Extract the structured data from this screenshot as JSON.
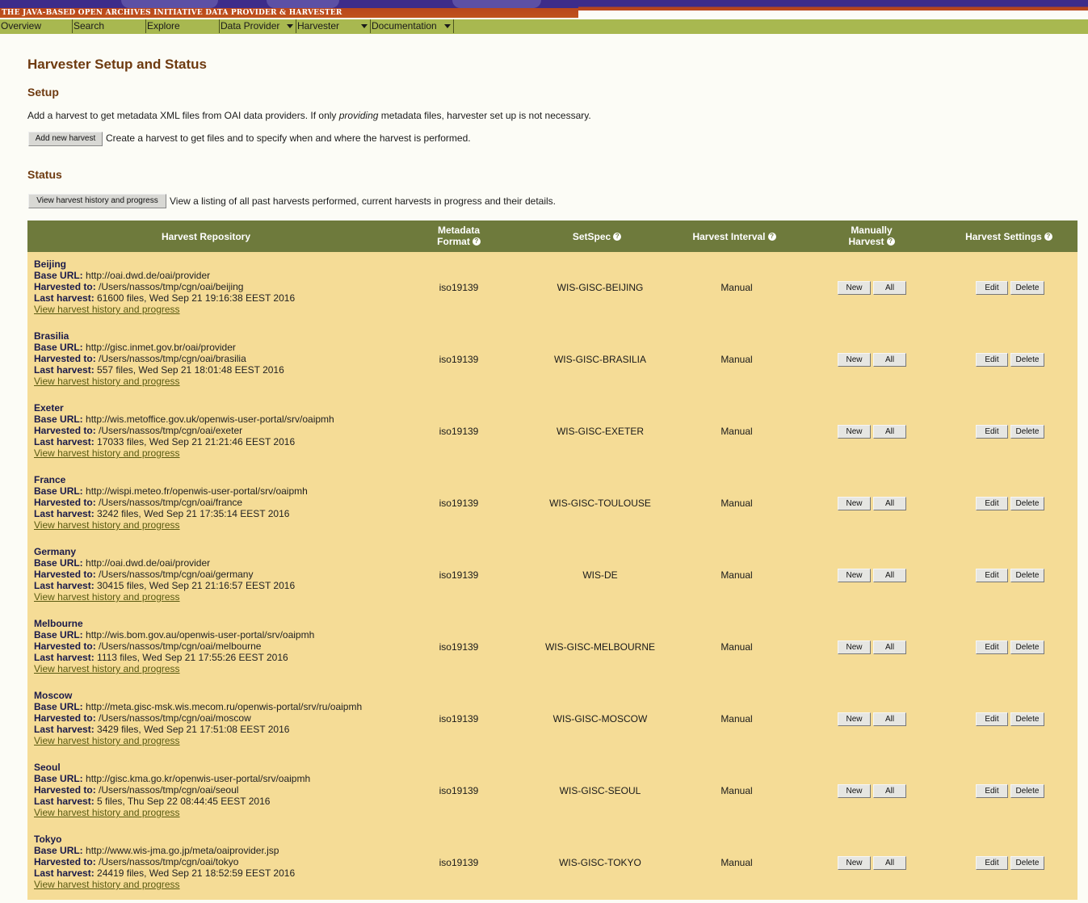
{
  "banner": {
    "title": "THE JAVA-BASED OPEN ARCHIVES INITIATIVE DATA PROVIDER & HARVESTER"
  },
  "nav": [
    {
      "label": "Overview",
      "dropdown": false
    },
    {
      "label": "Search",
      "dropdown": false
    },
    {
      "label": "Explore",
      "dropdown": false
    },
    {
      "label": "Data Provider",
      "dropdown": true
    },
    {
      "label": "Harvester",
      "dropdown": true
    },
    {
      "label": "Documentation",
      "dropdown": true
    }
  ],
  "page_title": "Harvester Setup and Status",
  "setup": {
    "heading": "Setup",
    "desc_before": "Add a harvest to get metadata XML files from OAI data providers. If only ",
    "desc_em": "providing",
    "desc_after": " metadata files, harvester set up is not necessary.",
    "add_button": "Add new harvest",
    "add_desc": "Create a harvest to get files and to specify when and where the harvest is performed."
  },
  "status": {
    "heading": "Status",
    "history_button": "View harvest history and progress",
    "history_desc": "View a listing of all past harvests performed, current harvests in progress and their details."
  },
  "table": {
    "headers": {
      "repository": "Harvest Repository",
      "format_line1": "Metadata",
      "format_line2": "Format",
      "setspec": "SetSpec",
      "interval": "Harvest Interval",
      "manual_line1": "Manually",
      "manual_line2": "Harvest",
      "settings": "Harvest Settings"
    },
    "labels": {
      "base_url": "Base URL:",
      "harvested_to": "Harvested to:",
      "last_harvest": "Last harvest:",
      "history_link": "View harvest history and progress",
      "new": "New",
      "all": "All",
      "edit": "Edit",
      "delete": "Delete"
    },
    "rows": [
      {
        "name": "Beijing",
        "base_url": "http://oai.dwd.de/oai/provider",
        "harvested_to": "/Users/nassos/tmp/cgn/oai/beijing",
        "last_harvest": "61600 files, Wed Sep 21 19:16:38 EEST 2016",
        "format": "iso19139",
        "setspec": "WIS-GISC-BEIJING",
        "interval": "Manual"
      },
      {
        "name": "Brasilia",
        "base_url": "http://gisc.inmet.gov.br/oai/provider",
        "harvested_to": "/Users/nassos/tmp/cgn/oai/brasilia",
        "last_harvest": "557 files, Wed Sep 21 18:01:48 EEST 2016",
        "format": "iso19139",
        "setspec": "WIS-GISC-BRASILIA",
        "interval": "Manual"
      },
      {
        "name": "Exeter",
        "base_url": "http://wis.metoffice.gov.uk/openwis-user-portal/srv/oaipmh",
        "harvested_to": "/Users/nassos/tmp/cgn/oai/exeter",
        "last_harvest": "17033 files, Wed Sep 21 21:21:46 EEST 2016",
        "format": "iso19139",
        "setspec": "WIS-GISC-EXETER",
        "interval": "Manual"
      },
      {
        "name": "France",
        "base_url": "http://wispi.meteo.fr/openwis-user-portal/srv/oaipmh",
        "harvested_to": "/Users/nassos/tmp/cgn/oai/france",
        "last_harvest": "3242 files, Wed Sep 21 17:35:14 EEST 2016",
        "format": "iso19139",
        "setspec": "WIS-GISC-TOULOUSE",
        "interval": "Manual"
      },
      {
        "name": "Germany",
        "base_url": "http://oai.dwd.de/oai/provider",
        "harvested_to": "/Users/nassos/tmp/cgn/oai/germany",
        "last_harvest": "30415 files, Wed Sep 21 21:16:57 EEST 2016",
        "format": "iso19139",
        "setspec": "WIS-DE",
        "interval": "Manual"
      },
      {
        "name": "Melbourne",
        "base_url": "http://wis.bom.gov.au/openwis-user-portal/srv/oaipmh",
        "harvested_to": "/Users/nassos/tmp/cgn/oai/melbourne",
        "last_harvest": "1113 files, Wed Sep 21 17:55:26 EEST 2016",
        "format": "iso19139",
        "setspec": "WIS-GISC-MELBOURNE",
        "interval": "Manual"
      },
      {
        "name": "Moscow",
        "base_url": "http://meta.gisc-msk.wis.mecom.ru/openwis-portal/srv/ru/oaipmh",
        "harvested_to": "/Users/nassos/tmp/cgn/oai/moscow",
        "last_harvest": "3429 files, Wed Sep 21 17:51:08 EEST 2016",
        "format": "iso19139",
        "setspec": "WIS-GISC-MOSCOW",
        "interval": "Manual"
      },
      {
        "name": "Seoul",
        "base_url": "http://gisc.kma.go.kr/openwis-user-portal/srv/oaipmh",
        "harvested_to": "/Users/nassos/tmp/cgn/oai/seoul",
        "last_harvest": "5 files, Thu Sep 22 08:44:45 EEST 2016",
        "format": "iso19139",
        "setspec": "WIS-GISC-SEOUL",
        "interval": "Manual"
      },
      {
        "name": "Tokyo",
        "base_url": "http://www.wis-jma.go.jp/meta/oaiprovider.jsp",
        "harvested_to": "/Users/nassos/tmp/cgn/oai/tokyo",
        "last_harvest": "24419 files, Wed Sep 21 18:52:59 EEST 2016",
        "format": "iso19139",
        "setspec": "WIS-GISC-TOKYO",
        "interval": "Manual"
      }
    ]
  }
}
